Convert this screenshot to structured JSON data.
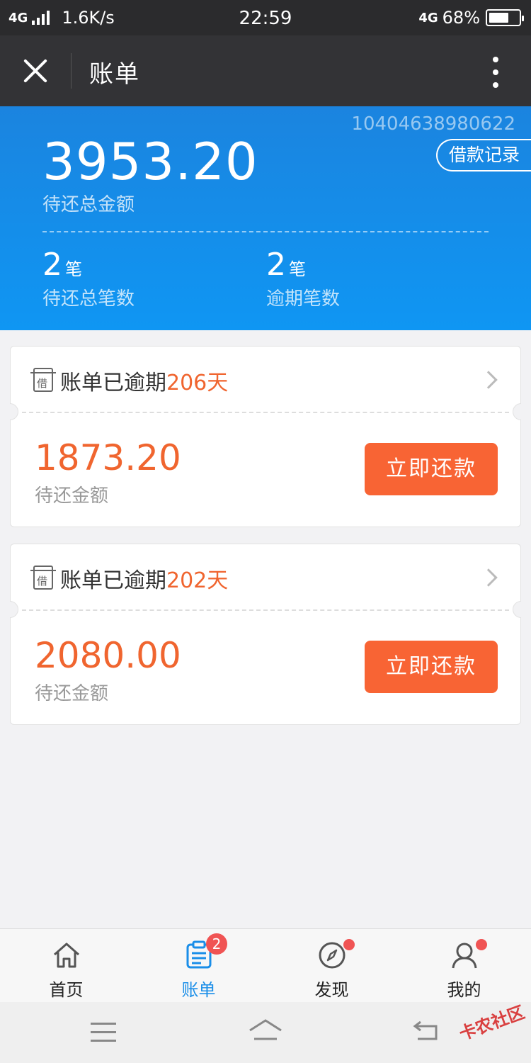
{
  "status_bar": {
    "network": "4G",
    "speed": "1.6K/s",
    "time": "22:59",
    "network_right": "4G",
    "battery_percent": "68%",
    "battery_level": 0.68
  },
  "nav": {
    "title": "账单",
    "close_icon": "close-icon",
    "more_icon": "more-vertical-icon"
  },
  "summary": {
    "account_no": "10404638980622",
    "record_button": "借款记录",
    "total_amount": "3953.20",
    "total_label": "待还总金额",
    "count_total": "2",
    "count_total_unit": "笔",
    "count_total_label": "待还总笔数",
    "count_overdue": "2",
    "count_overdue_unit": "笔",
    "count_overdue_label": "逾期笔数"
  },
  "bills": [
    {
      "title_prefix": "账单已逾期",
      "days": "206天",
      "icon_text": "借",
      "amount": "1873.20",
      "amount_label": "待还金额",
      "pay_label": "立即还款"
    },
    {
      "title_prefix": "账单已逾期",
      "days": "202天",
      "icon_text": "借",
      "amount": "2080.00",
      "amount_label": "待还金额",
      "pay_label": "立即还款"
    }
  ],
  "tabs": [
    {
      "label": "首页",
      "icon": "home-icon"
    },
    {
      "label": "账单",
      "icon": "bill-icon",
      "badge": "2"
    },
    {
      "label": "发现",
      "icon": "compass-icon"
    },
    {
      "label": "我的",
      "icon": "user-icon"
    }
  ],
  "colors": {
    "accent_blue": "#1a8ee8",
    "overdue_orange": "#f0652f",
    "pay_button": "#f86434",
    "badge_red": "#f05454"
  },
  "watermark": "卡农社区"
}
